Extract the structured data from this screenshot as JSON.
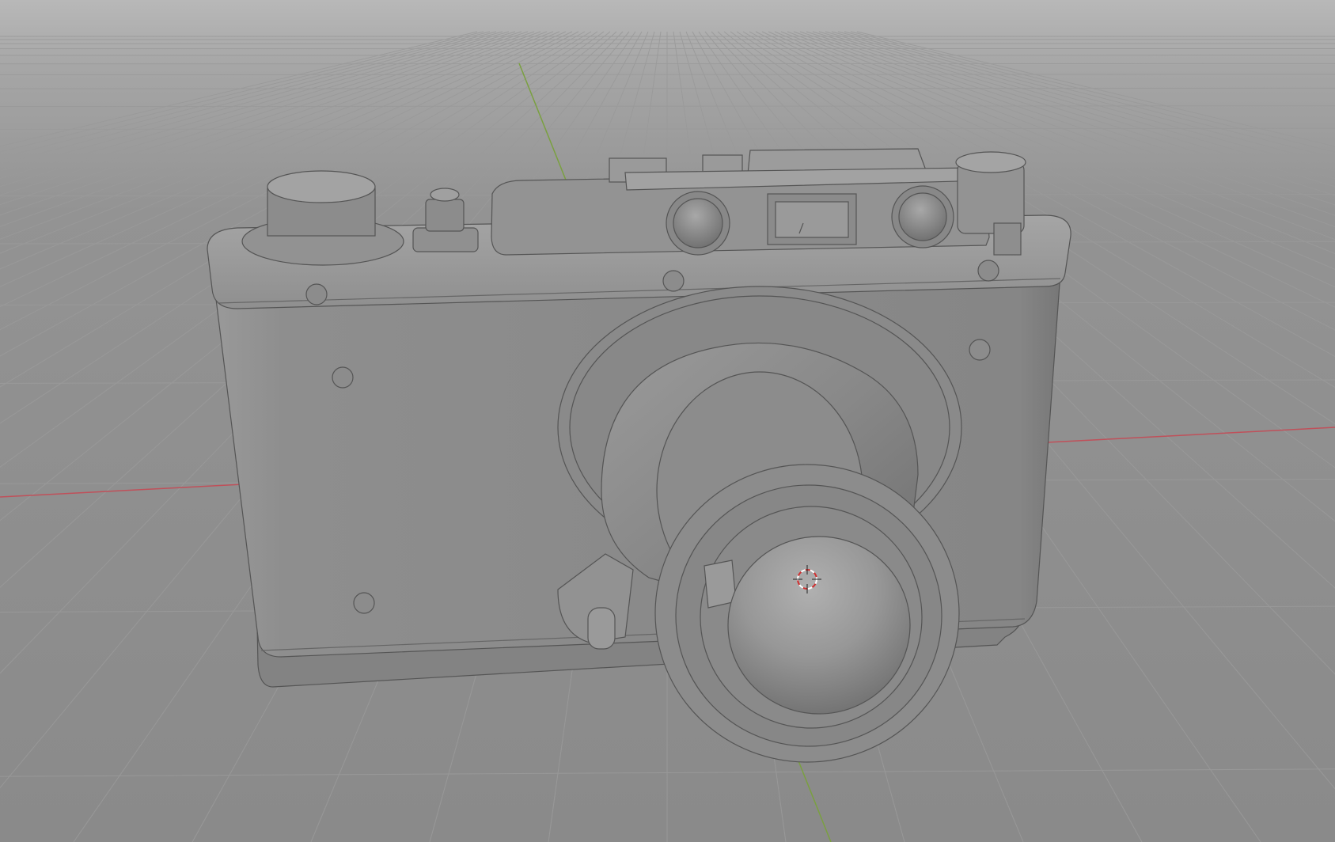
{
  "viewport": {
    "view_mode": "3D viewport",
    "shading_mode": "solid",
    "background_color": "#8b8b8b",
    "grid_color": "#9a9a9a",
    "x_axis_color": "#c0505a",
    "y_axis_color": "#7aa040",
    "model_color": "#8e8e8e",
    "object": "camera-model",
    "visible_axes": [
      "x-axis",
      "y-axis"
    ],
    "show_grid": true,
    "show_3d_cursor": true
  }
}
